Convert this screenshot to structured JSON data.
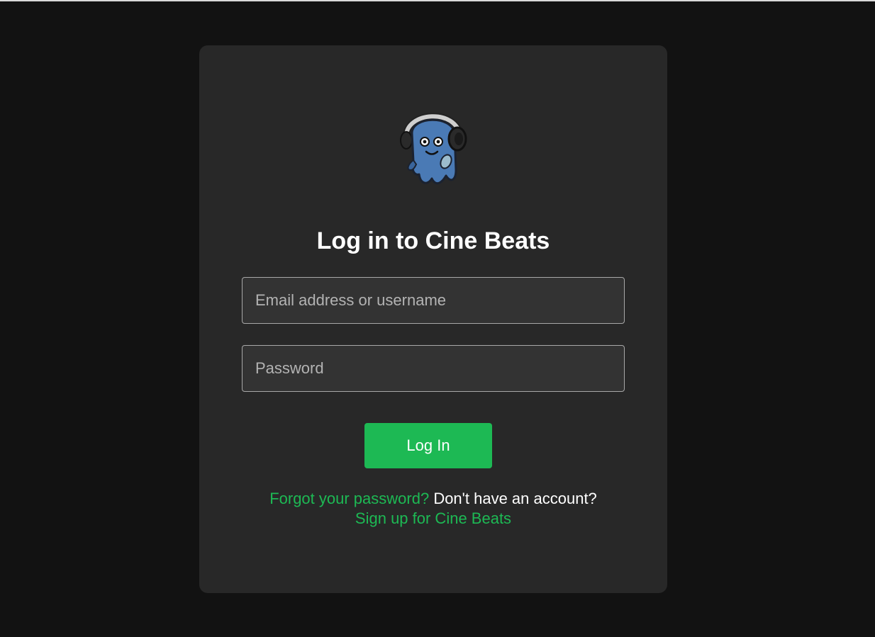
{
  "login": {
    "logo_icon": "ghost-headphones-mascot-icon",
    "title": "Log in to Cine Beats",
    "email_placeholder": "Email address or username",
    "password_placeholder": "Password",
    "login_button_label": "Log In",
    "forgot_password_link": "Forgot your password?",
    "no_account_text": "Don't have an account?",
    "signup_link": "Sign up for Cine Beats"
  },
  "colors": {
    "page_background": "#121212",
    "card_background": "#282828",
    "accent": "#1db954",
    "mascot_blue": "#4a7ab5"
  }
}
